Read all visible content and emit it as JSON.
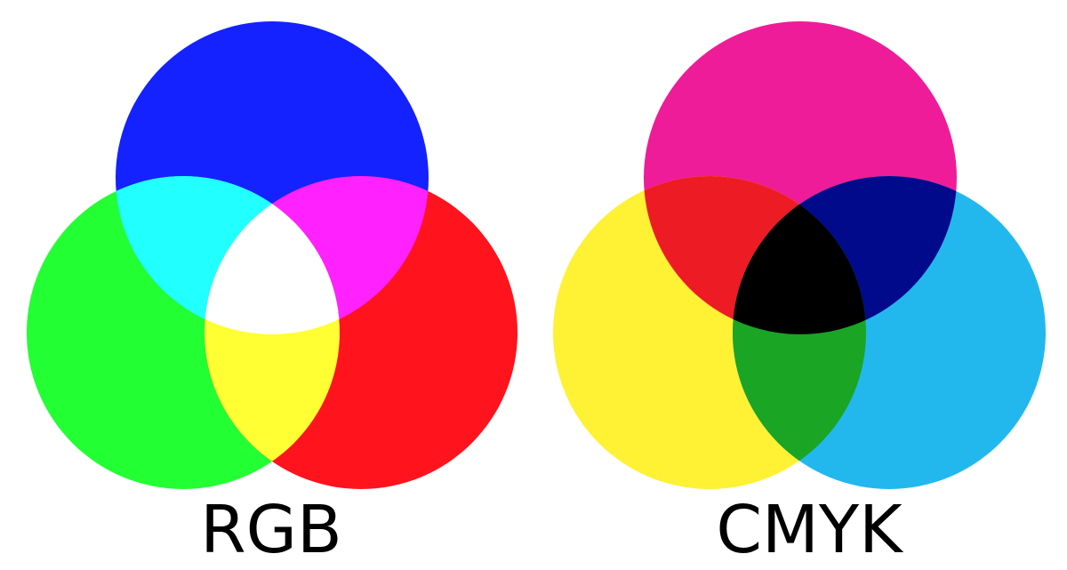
{
  "diagrams": [
    {
      "id": "rgb",
      "label": "RGB",
      "circles": [
        {
          "name": "blue-circle",
          "color": "#1322FF"
        },
        {
          "name": "green-circle",
          "color": "#22FF33"
        },
        {
          "name": "red-circle",
          "color": "#FF131D"
        }
      ],
      "overlaps": {
        "top-left": "#22FFFF",
        "top-right": "#FF22FF",
        "bottom": "#FFFF33",
        "center": "#FFFFFF"
      }
    },
    {
      "id": "cmyk",
      "label": "CMYK",
      "circles": [
        {
          "name": "magenta-circle",
          "color": "#EE1C98"
        },
        {
          "name": "yellow-circle",
          "color": "#FFF133"
        },
        {
          "name": "cyan-circle",
          "color": "#22B8EE"
        }
      ],
      "overlaps": {
        "top-left": "#ED1C24",
        "top-right": "#020A8C",
        "bottom": "#1AA524",
        "center": "#000000"
      }
    }
  ]
}
